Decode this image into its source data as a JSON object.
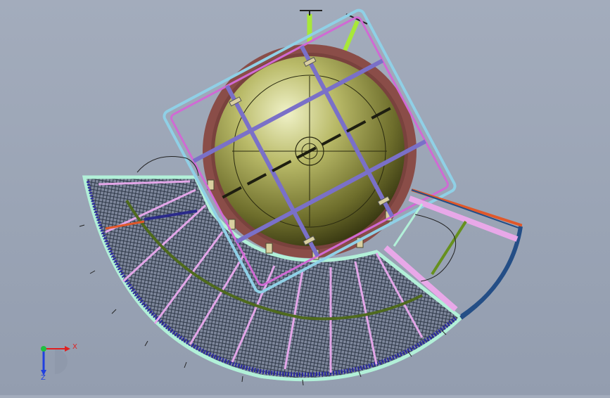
{
  "viewport": {
    "background_top": "#a3acbc",
    "background_bottom": "#939daf"
  },
  "colors": {
    "sphere_light": "#e8ebb8",
    "sphere_mid": "#9a9a48",
    "sphere_dark": "#3c3c14",
    "sphere_ring": "#8a4d48",
    "frame_outer": "#8fd0e6",
    "frame_inner": "#d06ad4",
    "frame_strut": "#7a70c8",
    "mesh_line": "#2a3040",
    "mesh_fill": "#7c8599",
    "mesh_rim_outer": "#b2f0d8",
    "mesh_rim_inner": "#2a2aa0",
    "rib_pink": "#e3a6e8",
    "rib_green": "#4f6a1e",
    "arm_orange": "#e0582a",
    "arm_navy": "#244e86",
    "arm_pink": "#e8a8e8",
    "arm_green": "#66901e",
    "mast": "#a8e838",
    "bracket": "#d9cfa0",
    "axis_x": "#e02020",
    "axis_y": "#20c040",
    "axis_z": "#2040e0"
  },
  "triad": {
    "x_label": "X",
    "y_label": "Z"
  }
}
